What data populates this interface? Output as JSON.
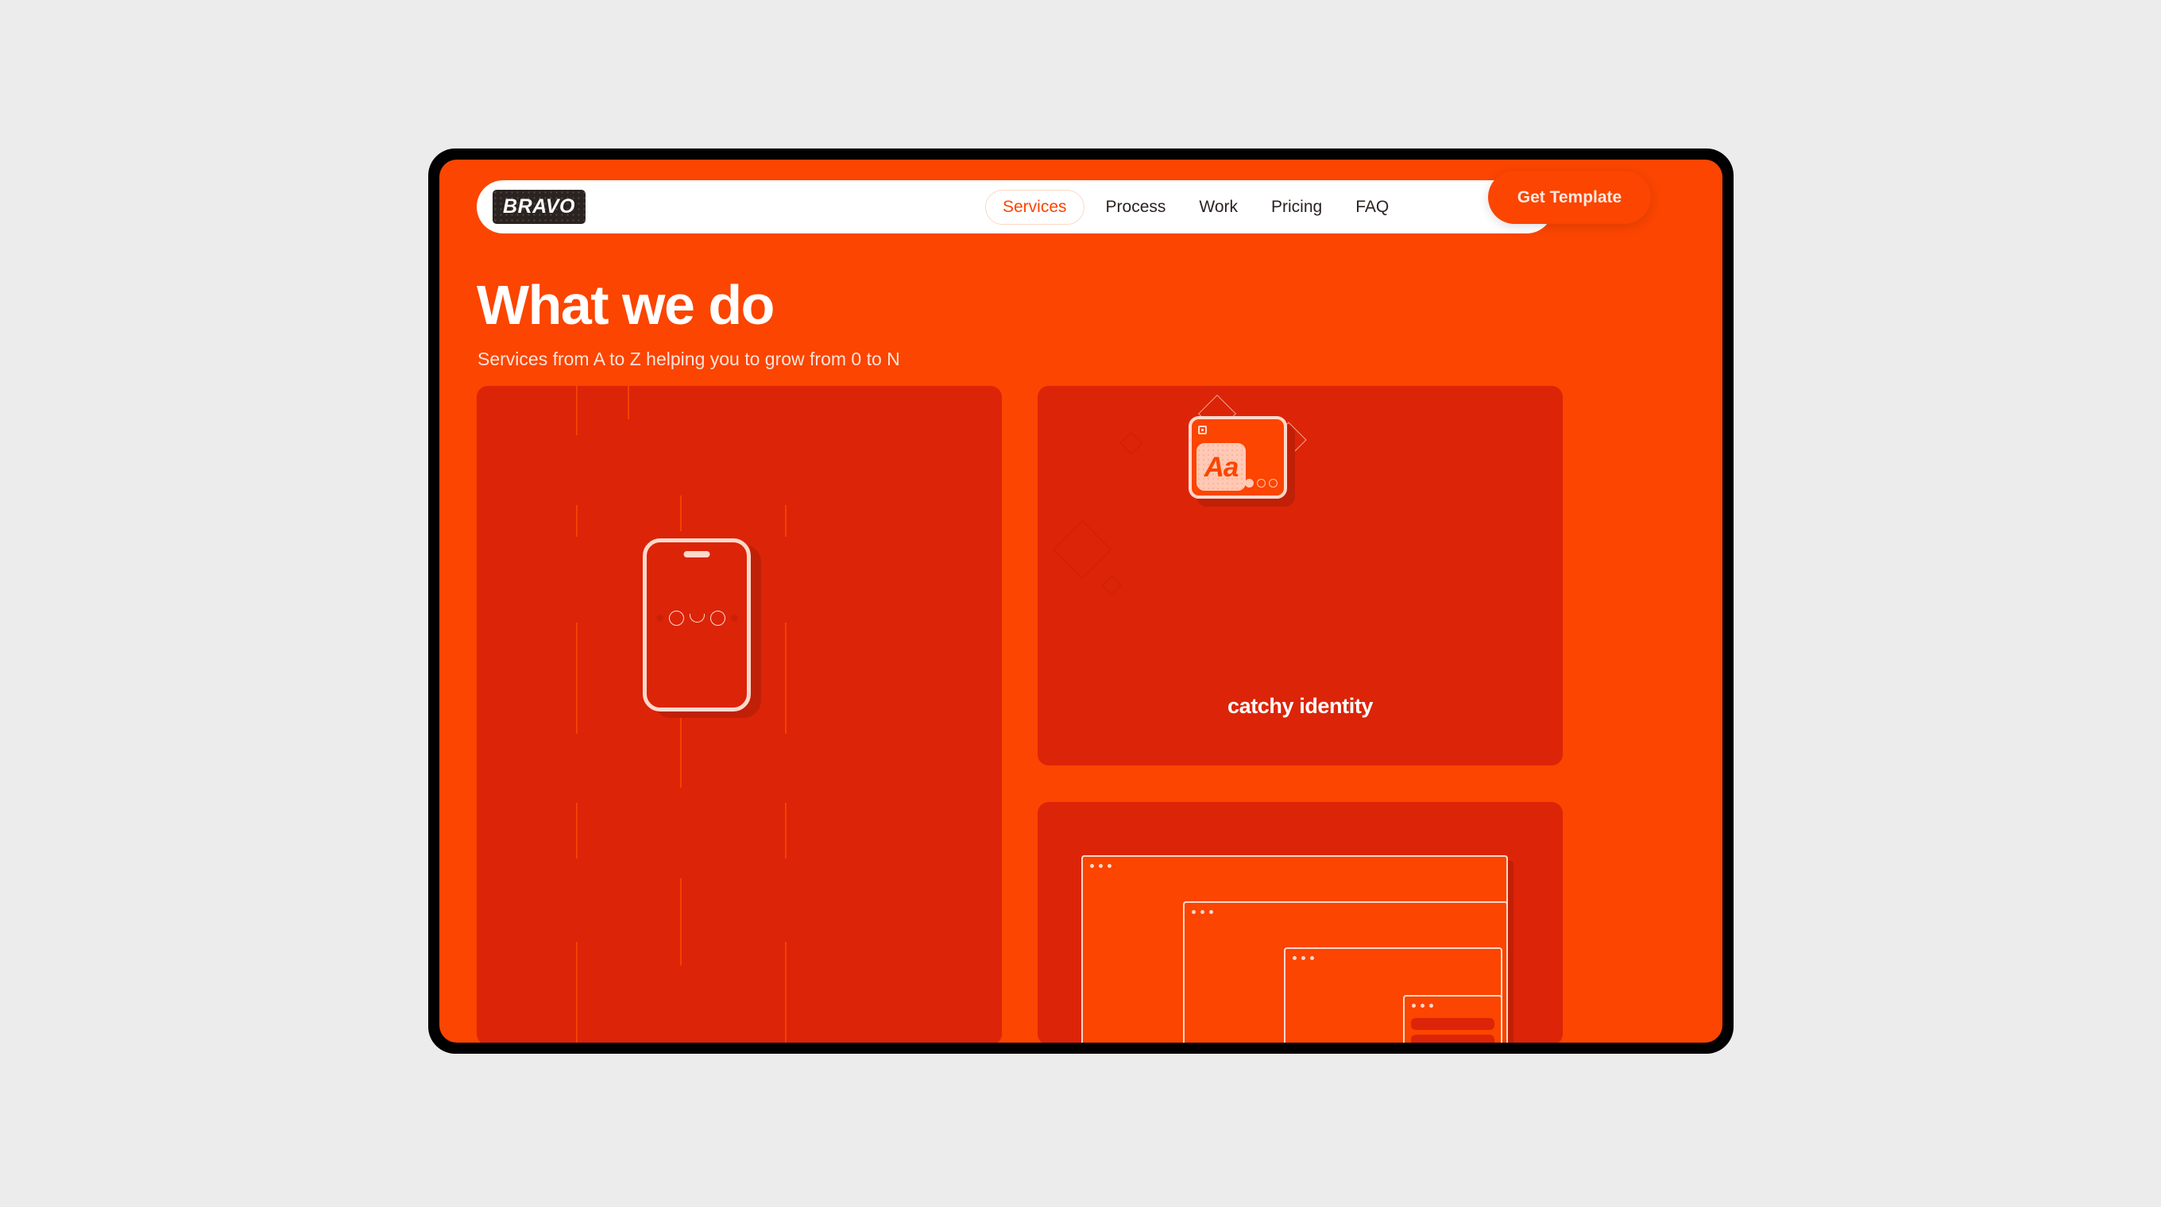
{
  "page": {
    "background_color": "#ececec",
    "frame_color": "#000000",
    "brand_orange": "#FB4500",
    "card_red": "#DC2408",
    "shadow_red": "#C02007",
    "cream": "#ffd9cc"
  },
  "navbar": {
    "logo_text": "BRAVO",
    "links": [
      {
        "label": "Services",
        "active": true
      },
      {
        "label": "Process",
        "active": false
      },
      {
        "label": "Work",
        "active": false
      },
      {
        "label": "Pricing",
        "active": false
      },
      {
        "label": "FAQ",
        "active": false
      }
    ],
    "cta_label": "Get Template"
  },
  "hero": {
    "title": "What we do",
    "subtitle": "Services from A to Z helping you to grow from 0 to N"
  },
  "cards": [
    {
      "id": "phone",
      "illustration": "smiling-phone",
      "label": ""
    },
    {
      "id": "identity",
      "illustration": "app-window-typography",
      "sample_text": "Aa",
      "label": "catchy identity"
    },
    {
      "id": "windows",
      "illustration": "nested-browser-windows",
      "label": ""
    }
  ]
}
